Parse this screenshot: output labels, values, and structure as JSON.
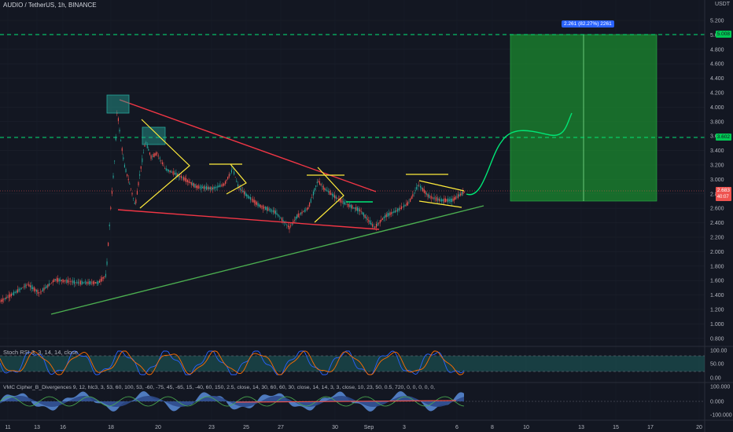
{
  "symbol": "AUDIO / TetherUS, 1h, BINANCE",
  "currency": "USDT",
  "price_axis": [
    "5.200",
    "5.000",
    "4.800",
    "4.600",
    "4.400",
    "4.200",
    "4.000",
    "3.800",
    "3.600",
    "3.400",
    "3.200",
    "3.000",
    "2.800",
    "2.600",
    "2.400",
    "2.200",
    "2.000",
    "1.800",
    "1.600",
    "1.400",
    "1.200",
    "1.000",
    "0.800"
  ],
  "current_price": "2.683",
  "current_sub": "40:07",
  "target_price": "5.008",
  "level_price": "3.602",
  "position_label": "2.261 (82.27%) 2261",
  "x_axis": [
    "11",
    "13",
    "16",
    "18",
    "20",
    "23",
    "25",
    "27",
    "30",
    "Sep",
    "3",
    "6",
    "8",
    "10",
    "13",
    "15",
    "17",
    "20"
  ],
  "stoch": {
    "label": "Stoch RSI 3, 3, 14, 14, close",
    "levels": [
      "100.00",
      "50.00",
      "0.00"
    ]
  },
  "vmc": {
    "label": "VMC Cipher_B_Divergences 9, 12, hlc3, 3, 53, 60, 100, 53, -60, -75, 45, -65, 15, -40, 60, 150, 2.5, close, 14, 30, 60, 60, 30, close, 14, 14, 3, 3, close, 10, 23, 50, 0.5, 720, 0, 0, 0, 0, 0, 60, 240, 0, 0, 240",
    "levels": [
      "100.000",
      "0.000",
      "-100.000"
    ]
  },
  "colors": {
    "background": "#131722",
    "up": "#26a69a",
    "down": "#ef5350",
    "trend_red": "#f23645",
    "trend_green": "#4caf50",
    "pattern": "#ffeb3b",
    "target_zone": "#1b8a2f",
    "level_line": "#00e676"
  }
}
